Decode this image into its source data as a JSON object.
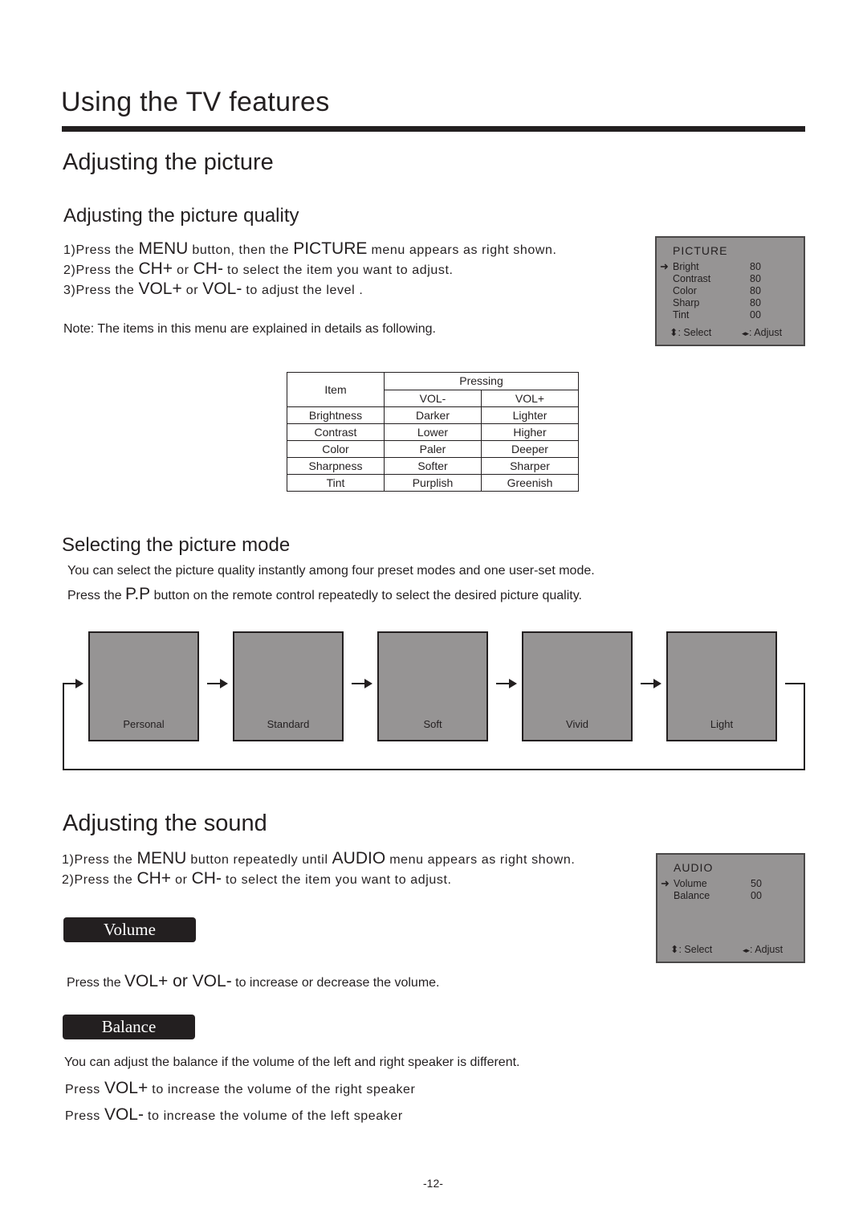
{
  "page": {
    "title": "Using the TV features",
    "page_number": "-12-"
  },
  "picture": {
    "heading": "Adjusting the picture",
    "quality": {
      "heading": "Adjusting the picture quality",
      "steps": [
        {
          "num": "1)",
          "pre": "Press the ",
          "key1": "MENU",
          "mid": " button, then the ",
          "key2": "PICTURE",
          "post": " menu appears as right shown."
        },
        {
          "num": "2)",
          "pre": "Press the ",
          "key1": "CH+",
          "mid": " or ",
          "key2": "CH-",
          "post": " to select the item you want to adjust."
        },
        {
          "num": "3)",
          "pre": "Press  the ",
          "key1": "VOL+",
          "mid": " or ",
          "key2": "VOL-",
          "post": " to adjust the level ."
        }
      ],
      "note": "Note: The items in this menu are explained in details as following."
    },
    "osd": {
      "title": "PICTURE",
      "items": [
        {
          "label": "Bright",
          "value": "80",
          "selected": true
        },
        {
          "label": "Contrast",
          "value": "80"
        },
        {
          "label": "Color",
          "value": "80"
        },
        {
          "label": "Sharp",
          "value": "80"
        },
        {
          "label": "Tint",
          "value": "00"
        }
      ],
      "select_hint": ": Select",
      "adjust_hint": ": Adjust",
      "arrow_glyph": "➜",
      "updown_glyph": "⬍",
      "leftright_glyph": "◂▸"
    },
    "table": {
      "col_item": "Item",
      "col_pressing": "Pressing",
      "col_minus": "VOL-",
      "col_plus": "VOL+",
      "rows": [
        {
          "item": "Brightness",
          "minus": "Darker",
          "plus": "Lighter"
        },
        {
          "item": "Contrast",
          "minus": "Lower",
          "plus": "Higher"
        },
        {
          "item": "Color",
          "minus": "Paler",
          "plus": "Deeper"
        },
        {
          "item": "Sharpness",
          "minus": "Softer",
          "plus": "Sharper"
        },
        {
          "item": "Tint",
          "minus": "Purplish",
          "plus": "Greenish"
        }
      ]
    },
    "mode": {
      "heading": "Selecting the picture mode",
      "line1": "You can select the picture quality instantly among four preset modes and one user-set mode.",
      "line2_pre": "Press the ",
      "line2_key": "P.P",
      "line2_post": " button on the remote control repeatedly to select the desired picture quality.",
      "modes": [
        "Personal",
        "Standard",
        "Soft",
        "Vivid",
        "Light"
      ]
    }
  },
  "sound": {
    "heading": "Adjusting the sound",
    "steps": [
      {
        "num": "1)",
        "pre": "Press the ",
        "key1": "MENU",
        "mid": " button repeatedly until ",
        "key2": "AUDIO",
        "post": " menu appears as  right shown."
      },
      {
        "num": "2)",
        "pre": "Press the ",
        "key1": "CH+",
        "mid": " or ",
        "key2": "CH-",
        "post": " to select the item you want to  adjust."
      }
    ],
    "osd": {
      "title": "AUDIO",
      "items": [
        {
          "label": "Volume",
          "value": "50",
          "selected": true
        },
        {
          "label": "Balance",
          "value": "00"
        }
      ],
      "select_hint": ": Select",
      "adjust_hint": ": Adjust",
      "arrow_glyph": "➜",
      "updown_glyph": "⬍",
      "leftright_glyph": "◂▸"
    },
    "volume": {
      "label": "Volume",
      "text_pre": "Press the ",
      "key1": "VOL+",
      "mid": " or ",
      "key2": "VOL-",
      "text_post": " to increase or decrease the volume."
    },
    "balance": {
      "label": "Balance",
      "intro": "You can adjust the balance if the volume of the left and right speaker is different.",
      "line1_pre": "Press ",
      "line1_key": "VOL+",
      "line1_post": " to  increase the volume of the right speaker",
      "line2_pre": "Press ",
      "line2_key": "VOL-",
      "line2_post": " to  increase the volume of the left speaker"
    }
  },
  "colors": {
    "text": "#231f20",
    "osd_bg": "#969494",
    "pill_bg": "#231f20"
  }
}
